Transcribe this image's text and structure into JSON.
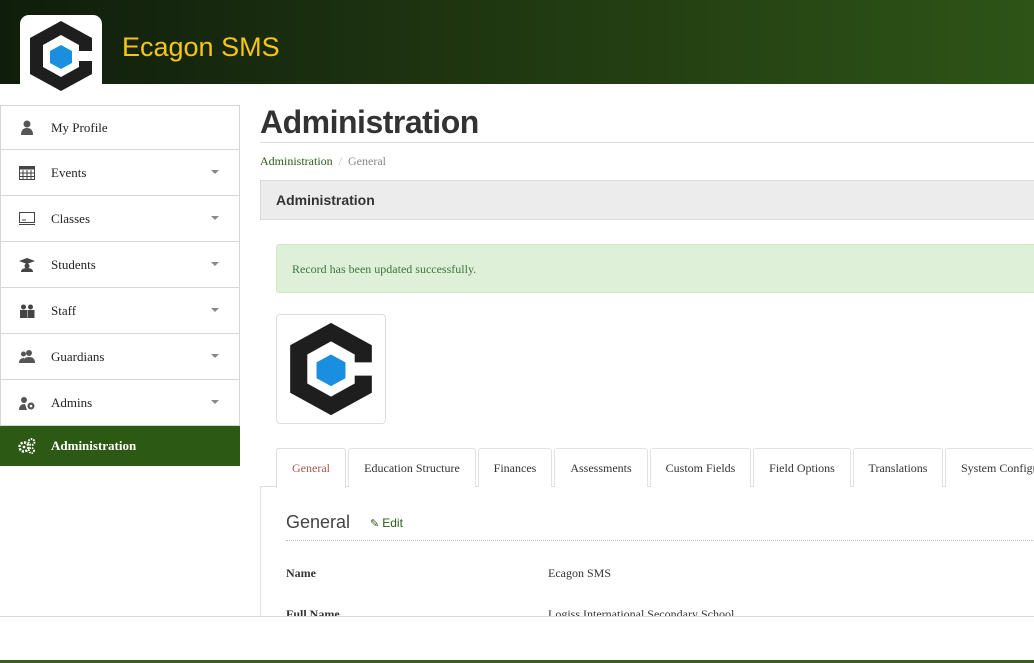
{
  "header": {
    "brand": "Ecagon SMS"
  },
  "sidebar": {
    "items": [
      {
        "label": "My Profile",
        "icon": "user-icon",
        "has_caret": false
      },
      {
        "label": "Events",
        "icon": "calendar-icon",
        "has_caret": true
      },
      {
        "label": "Classes",
        "icon": "chalkboard-icon",
        "has_caret": true
      },
      {
        "label": "Students",
        "icon": "graduation-cap-icon",
        "has_caret": true
      },
      {
        "label": "Staff",
        "icon": "staff-icon",
        "has_caret": true
      },
      {
        "label": "Guardians",
        "icon": "users-icon",
        "has_caret": true
      },
      {
        "label": "Admins",
        "icon": "user-shield-icon",
        "has_caret": true
      },
      {
        "label": "Administration",
        "icon": "gears-icon",
        "has_caret": false,
        "active": true
      }
    ]
  },
  "main": {
    "title": "Administration",
    "breadcrumb": {
      "link": "Administration",
      "separator": "/",
      "current": "General"
    },
    "panel_title": "Administration",
    "alert": "Record has been updated successfully.",
    "tabs": [
      {
        "label": "General",
        "active": true
      },
      {
        "label": "Education Structure"
      },
      {
        "label": "Finances"
      },
      {
        "label": "Assessments"
      },
      {
        "label": "Custom Fields"
      },
      {
        "label": "Field Options"
      },
      {
        "label": "Translations"
      },
      {
        "label": "System Configu"
      }
    ],
    "section": {
      "title": "General",
      "edit_label": "Edit"
    },
    "fields": [
      {
        "label": "Name",
        "value": "Ecagon SMS"
      },
      {
        "label": "Full Name",
        "value": "Logiss International Secondary School"
      }
    ]
  },
  "colors": {
    "accent": "#2c5a15",
    "brand_yellow": "#f5c518",
    "alert_bg": "#dff0d8",
    "logo_blue": "#1a8fe0"
  }
}
